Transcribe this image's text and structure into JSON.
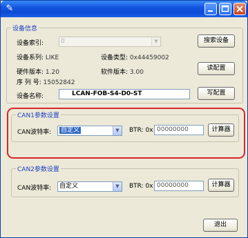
{
  "window": {
    "title_icon": "tool-icon",
    "buttons": {
      "minimize": "minimize-icon",
      "maximize": "maximize-icon",
      "close": "close-icon"
    }
  },
  "device_info": {
    "legend": "设备信息",
    "index_label": "设备索引:",
    "index_value": "0",
    "series_label": "设备系列:",
    "series_value": "LIKE",
    "type_label": "设备类型:",
    "type_value": "0x44459002",
    "hw_label": "硬件版本:",
    "hw_value": "1.20",
    "sw_label": "软件版本:",
    "sw_value": "3.00",
    "serial_label": "序 列 号:",
    "serial_value": "15052842",
    "name_label": "设备名称:",
    "name_value": "LCAN-FOB-S4-D0-ST",
    "search_button": "搜索设备",
    "read_button": "读配置",
    "write_button": "写配置"
  },
  "can1": {
    "legend": "CAN1参数设置",
    "baud_label": "CAN波特率:",
    "baud_value": "自定义",
    "btr_label": "BTR: 0x",
    "btr_value": "00000000",
    "calc_button": "计算器"
  },
  "can2": {
    "legend": "CAN2参数设置",
    "baud_label": "CAN波特率:",
    "baud_value": "自定义",
    "btr_label": "BTR: 0x",
    "btr_value": "00000000",
    "calc_button": "计算器"
  },
  "footer": {
    "exit_button": "退出"
  },
  "colors": {
    "highlight": "#d9252a",
    "title_bar": "#0d4bd6",
    "legend_text": "#1a3fc0"
  }
}
